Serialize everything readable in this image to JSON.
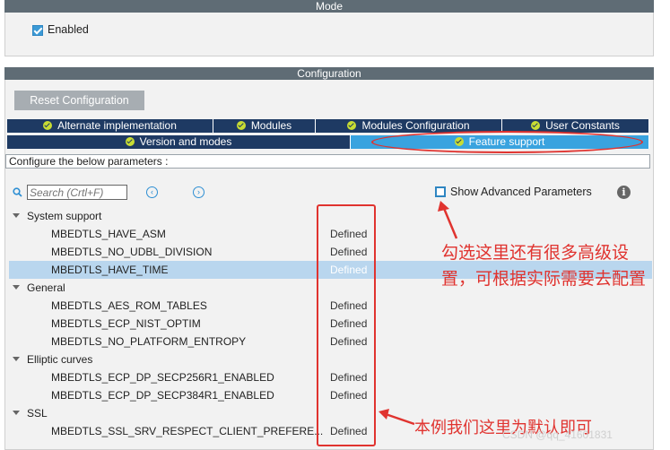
{
  "mode": {
    "header": "Mode",
    "enabled_label": "Enabled",
    "enabled_checked": true
  },
  "configuration": {
    "header": "Configuration",
    "reset_button": "Reset Configuration",
    "tabs_row1": [
      "Alternate implementation",
      "Modules",
      "Modules Configuration",
      "User Constants"
    ],
    "tabs_row2": [
      "Version and modes",
      "Feature support"
    ],
    "active_tab": "Feature support",
    "description": "Configure the below parameters :",
    "search_placeholder": "Search (Crtl+F)",
    "show_advanced_label": "Show Advanced Parameters",
    "show_advanced_checked": false,
    "groups": [
      {
        "name": "System support",
        "params": [
          {
            "name": "MBEDTLS_HAVE_ASM",
            "value": "Defined"
          },
          {
            "name": "MBEDTLS_NO_UDBL_DIVISION",
            "value": "Defined"
          },
          {
            "name": "MBEDTLS_HAVE_TIME",
            "value": "Defined",
            "selected": true
          }
        ]
      },
      {
        "name": "General",
        "params": [
          {
            "name": "MBEDTLS_AES_ROM_TABLES",
            "value": "Defined"
          },
          {
            "name": "MBEDTLS_ECP_NIST_OPTIM",
            "value": "Defined"
          },
          {
            "name": "MBEDTLS_NO_PLATFORM_ENTROPY",
            "value": "Defined"
          }
        ]
      },
      {
        "name": "Elliptic curves",
        "params": [
          {
            "name": "MBEDTLS_ECP_DP_SECP256R1_ENABLED",
            "value": "Defined"
          },
          {
            "name": "MBEDTLS_ECP_DP_SECP384R1_ENABLED",
            "value": "Defined"
          }
        ]
      },
      {
        "name": "SSL",
        "params": [
          {
            "name": "MBEDTLS_SSL_SRV_RESPECT_CLIENT_PREFERE...",
            "value": "Defined"
          }
        ]
      }
    ]
  },
  "annotations": {
    "advanced_note": "勾选这里还有很多高级设置，可根据实际需要去配置",
    "default_note": "本例我们这里为默认即可"
  },
  "watermark": "CSDN @qq_41601831",
  "colors": {
    "tab_bg": "#1e3a63",
    "tab_active": "#39a3df",
    "annotation_red": "#e0332f"
  }
}
